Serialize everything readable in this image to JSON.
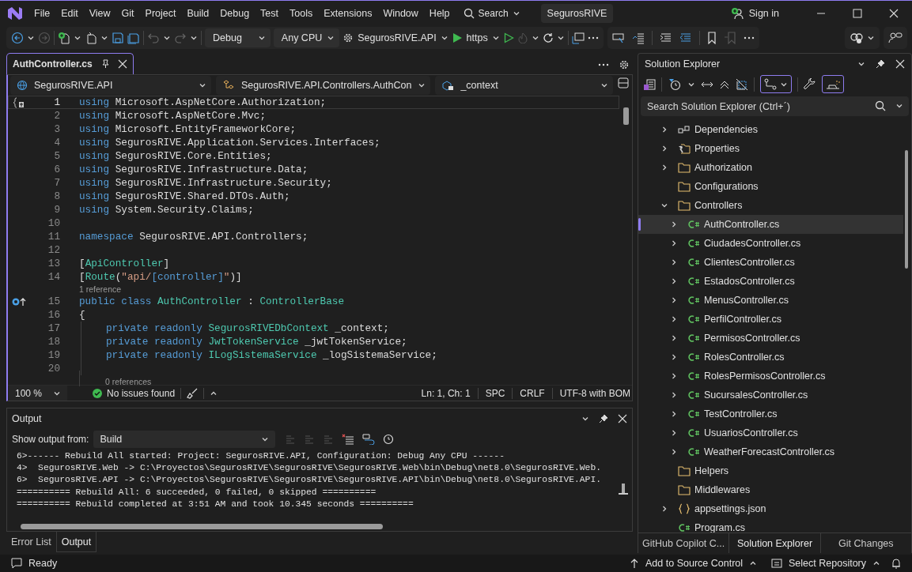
{
  "title_bar": {
    "menu": [
      "File",
      "Edit",
      "View",
      "Git",
      "Project",
      "Build",
      "Debug",
      "Test",
      "Tools",
      "Extensions",
      "Window",
      "Help"
    ],
    "search": "Search",
    "solution": "SegurosRIVE",
    "sign_in": "Sign in"
  },
  "toolbar": {
    "configuration": "Debug",
    "platform": "Any CPU",
    "startup_project": "SegurosRIVE.API",
    "launch_profile": "https"
  },
  "editor": {
    "tab": {
      "title": "AuthController.cs",
      "selected": true
    },
    "nav": [
      "SegurosRIVE.API",
      "SegurosRIVE.API.Controllers.AuthCon",
      "_context"
    ],
    "lines": [
      {
        "kind": "code",
        "number": "1",
        "current": true,
        "gutter": {
          "kind": "outline"
        },
        "tokens": [
          {
            "t": "using",
            "kind": "kw"
          },
          {
            "t": " Microsoft.AspNetCore.Authorization;",
            "kind": "plain"
          }
        ]
      },
      {
        "kind": "code",
        "number": "2",
        "current": false,
        "tokens": [
          {
            "t": "using",
            "kind": "kw"
          },
          {
            "t": " Microsoft.AspNetCore.Mvc;",
            "kind": "plain"
          }
        ]
      },
      {
        "kind": "code",
        "number": "3",
        "current": false,
        "tokens": [
          {
            "t": "using",
            "kind": "kw"
          },
          {
            "t": " Microsoft.EntityFrameworkCore;",
            "kind": "plain"
          }
        ]
      },
      {
        "kind": "code",
        "number": "4",
        "current": false,
        "tokens": [
          {
            "t": "using",
            "kind": "kw"
          },
          {
            "t": " SegurosRIVE.Application.Services.Interfaces;",
            "kind": "plain"
          }
        ]
      },
      {
        "kind": "code",
        "number": "5",
        "current": false,
        "tokens": [
          {
            "t": "using",
            "kind": "kw"
          },
          {
            "t": " SegurosRIVE.Core.Entities;",
            "kind": "plain"
          }
        ]
      },
      {
        "kind": "code",
        "number": "6",
        "current": false,
        "tokens": [
          {
            "t": "using",
            "kind": "kw"
          },
          {
            "t": " SegurosRIVE.Infrastructure.Data;",
            "kind": "plain"
          }
        ]
      },
      {
        "kind": "code",
        "number": "7",
        "current": false,
        "tokens": [
          {
            "t": "using",
            "kind": "kw"
          },
          {
            "t": " SegurosRIVE.Infrastructure.Security;",
            "kind": "plain"
          }
        ]
      },
      {
        "kind": "code",
        "number": "8",
        "current": false,
        "tokens": [
          {
            "t": "using",
            "kind": "kw"
          },
          {
            "t": " SegurosRIVE.Shared.DTOs.Auth;",
            "kind": "plain"
          }
        ]
      },
      {
        "kind": "code",
        "number": "9",
        "current": false,
        "tokens": [
          {
            "t": "using",
            "kind": "kw"
          },
          {
            "t": " System.Security.Claims;",
            "kind": "plain"
          }
        ]
      },
      {
        "kind": "code",
        "number": "10",
        "current": false
      },
      {
        "kind": "code",
        "number": "11",
        "current": false,
        "tokens": [
          {
            "t": "namespace",
            "kind": "kw"
          },
          {
            "t": " SegurosRIVE.API.Controllers;",
            "kind": "plain"
          }
        ]
      },
      {
        "kind": "code",
        "number": "12",
        "current": false
      },
      {
        "kind": "code",
        "number": "13",
        "current": false,
        "tokens": [
          {
            "t": "[",
            "kind": "plain"
          },
          {
            "t": "ApiController",
            "kind": "type"
          },
          {
            "t": "]",
            "kind": "plain"
          }
        ]
      },
      {
        "kind": "code",
        "number": "14",
        "current": false,
        "tokens": [
          {
            "t": "[",
            "kind": "plain"
          },
          {
            "t": "Route",
            "kind": "type"
          },
          {
            "t": "(",
            "kind": "plain"
          },
          {
            "t": "\"api/",
            "kind": "str"
          },
          {
            "t": "[controller]",
            "kind": "kw"
          },
          {
            "t": "\"",
            "kind": "str"
          },
          {
            "t": ")]",
            "kind": "plain"
          }
        ]
      },
      {
        "kind": "lens",
        "text": "1 reference"
      },
      {
        "kind": "code",
        "number": "15",
        "current": false,
        "gutter": {
          "kind": "inherit"
        },
        "tokens": [
          {
            "t": "public class",
            "kind": "kw"
          },
          {
            "t": " AuthController",
            "kind": "type"
          },
          {
            "t": " :",
            "kind": "plain"
          },
          {
            "t": " ControllerBase",
            "kind": "type"
          }
        ]
      },
      {
        "kind": "code",
        "number": "16",
        "current": false,
        "tokens": [
          {
            "t": "{",
            "kind": "plain"
          }
        ]
      },
      {
        "kind": "member",
        "number": "17",
        "current": false,
        "tokens": [
          {
            "t": "private readonly",
            "kind": "kw"
          },
          {
            "t": " SegurosRIVEDbContext",
            "kind": "type"
          },
          {
            "t": " _context;",
            "kind": "plain"
          }
        ]
      },
      {
        "kind": "member",
        "number": "18",
        "current": false,
        "tokens": [
          {
            "t": "private readonly",
            "kind": "kw"
          },
          {
            "t": " JwtTokenService",
            "kind": "type"
          },
          {
            "t": " _jwtTokenService;",
            "kind": "plain"
          }
        ]
      },
      {
        "kind": "member",
        "number": "19",
        "current": false,
        "tokens": [
          {
            "t": "private readonly",
            "kind": "kw"
          },
          {
            "t": " ILogSistemaService",
            "kind": "type"
          },
          {
            "t": " _logSistemaService;",
            "kind": "plain"
          }
        ]
      },
      {
        "kind": "member",
        "number": "20",
        "current": false
      },
      {
        "kind": "member_lens",
        "text": "0 references"
      }
    ],
    "status": {
      "zoom": "100 %",
      "issues": "No issues found",
      "position": "Ln: 1, Ch: 1",
      "whitespace": "SPC",
      "line_endings": "CRLF",
      "encoding": "UTF-8 with BOM"
    }
  },
  "output": {
    "title": "Output",
    "show_from_label": "Show output from:",
    "source": "Build",
    "lines": [
      "6>------ Rebuild All started: Project: SegurosRIVE.API, Configuration: Debug Any CPU ------",
      "4>  SegurosRIVE.Web -> C:\\Proyectos\\SegurosRIVE\\SegurosRIVE\\SegurosRIVE.Web\\bin\\Debug\\net8.0\\SegurosRIVE.Web.",
      "6>  SegurosRIVE.API -> C:\\Proyectos\\SegurosRIVE\\SegurosRIVE\\SegurosRIVE.API\\bin\\Debug\\net8.0\\SegurosRIVE.API.",
      "========== Rebuild All: 6 succeeded, 0 failed, 0 skipped ==========",
      "========== Rebuild completed at 3:51 AM and took 10.345 seconds =========="
    ]
  },
  "bottom_tabs": [
    {
      "label": "Error List",
      "selected": false
    },
    {
      "label": "Output",
      "selected": true
    }
  ],
  "solution_explorer": {
    "title": "Solution Explorer",
    "search_placeholder": "Search Solution Explorer (Ctrl+´)",
    "tree": [
      {
        "label": "Dependencies",
        "kind": "dependencies",
        "expanded": false,
        "selected": false
      },
      {
        "label": "Properties",
        "kind": "properties",
        "expanded": false,
        "selected": false
      },
      {
        "label": "Authorization",
        "kind": "folder",
        "expanded": false,
        "selected": false
      },
      {
        "label": "Configurations",
        "kind": "folder",
        "selected": false
      },
      {
        "label": "Controllers",
        "kind": "folder",
        "expanded": true,
        "selected": false,
        "children": [
          {
            "label": "AuthController.cs",
            "kind": "csharp",
            "expanded": false,
            "selected": true
          },
          {
            "label": "CiudadesController.cs",
            "kind": "csharp",
            "expanded": false,
            "selected": false
          },
          {
            "label": "ClientesController.cs",
            "kind": "csharp",
            "expanded": false,
            "selected": false
          },
          {
            "label": "EstadosController.cs",
            "kind": "csharp",
            "expanded": false,
            "selected": false
          },
          {
            "label": "MenusController.cs",
            "kind": "csharp",
            "expanded": false,
            "selected": false
          },
          {
            "label": "PerfilController.cs",
            "kind": "csharp",
            "expanded": false,
            "selected": false
          },
          {
            "label": "PermisosController.cs",
            "kind": "csharp",
            "expanded": false,
            "selected": false
          },
          {
            "label": "RolesController.cs",
            "kind": "csharp",
            "expanded": false,
            "selected": false
          },
          {
            "label": "RolesPermisosController.cs",
            "kind": "csharp",
            "expanded": false,
            "selected": false
          },
          {
            "label": "SucursalesController.cs",
            "kind": "csharp",
            "expanded": false,
            "selected": false
          },
          {
            "label": "TestController.cs",
            "kind": "csharp",
            "expanded": false,
            "selected": false
          },
          {
            "label": "UsuariosController.cs",
            "kind": "csharp",
            "expanded": false,
            "selected": false
          },
          {
            "label": "WeatherForecastController.cs",
            "kind": "csharp",
            "expanded": false,
            "selected": false
          }
        ]
      },
      {
        "label": "Helpers",
        "kind": "folder",
        "selected": false
      },
      {
        "label": "Middlewares",
        "kind": "folder",
        "selected": false
      },
      {
        "label": "appsettings.json",
        "kind": "json",
        "expanded": false,
        "selected": false
      },
      {
        "label": "Program.cs",
        "kind": "csharp",
        "selected": false
      }
    ],
    "tabs": [
      {
        "label": "GitHub Copilot C...",
        "selected": false
      },
      {
        "label": "Solution Explorer",
        "selected": true
      },
      {
        "label": "Git Changes",
        "selected": false
      }
    ]
  },
  "status_bar": {
    "state": "Ready",
    "source_control": "Add to Source Control",
    "repository": "Select Repository"
  }
}
